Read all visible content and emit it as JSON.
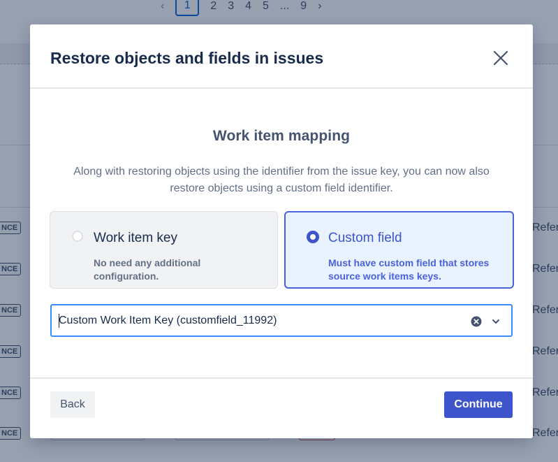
{
  "pagination": {
    "prev_icon": "chevron-left-icon",
    "pages": [
      "1",
      "2",
      "3",
      "4",
      "5",
      "...",
      "9"
    ],
    "current": "1",
    "next_icon": "chevron-right-icon"
  },
  "background": {
    "row_badge": "NCE",
    "row_text": "Refer"
  },
  "modal": {
    "title": "Restore objects and fields in issues",
    "close_icon": "close-icon",
    "section_title": "Work item mapping",
    "description": "Along with restoring objects using the identifier from the issue key, you can now also restore objects using a custom field identifier.",
    "options": [
      {
        "title": "Work item key",
        "description": "No need any additional configuration.",
        "selected": false
      },
      {
        "title": "Custom field",
        "description": "Must have custom field that stores source work items keys.",
        "selected": true
      }
    ],
    "select": {
      "value": "Custom Work Item Key (customfield_11992)",
      "clear_icon": "clear-circle-icon",
      "dropdown_icon": "chevron-down-icon"
    },
    "footer": {
      "back_label": "Back",
      "continue_label": "Continue"
    }
  },
  "colors": {
    "primary": "#3d54cb",
    "selected_bg": "#e9f2ff",
    "focus_border": "#388bff",
    "title_text": "#172b4d"
  }
}
